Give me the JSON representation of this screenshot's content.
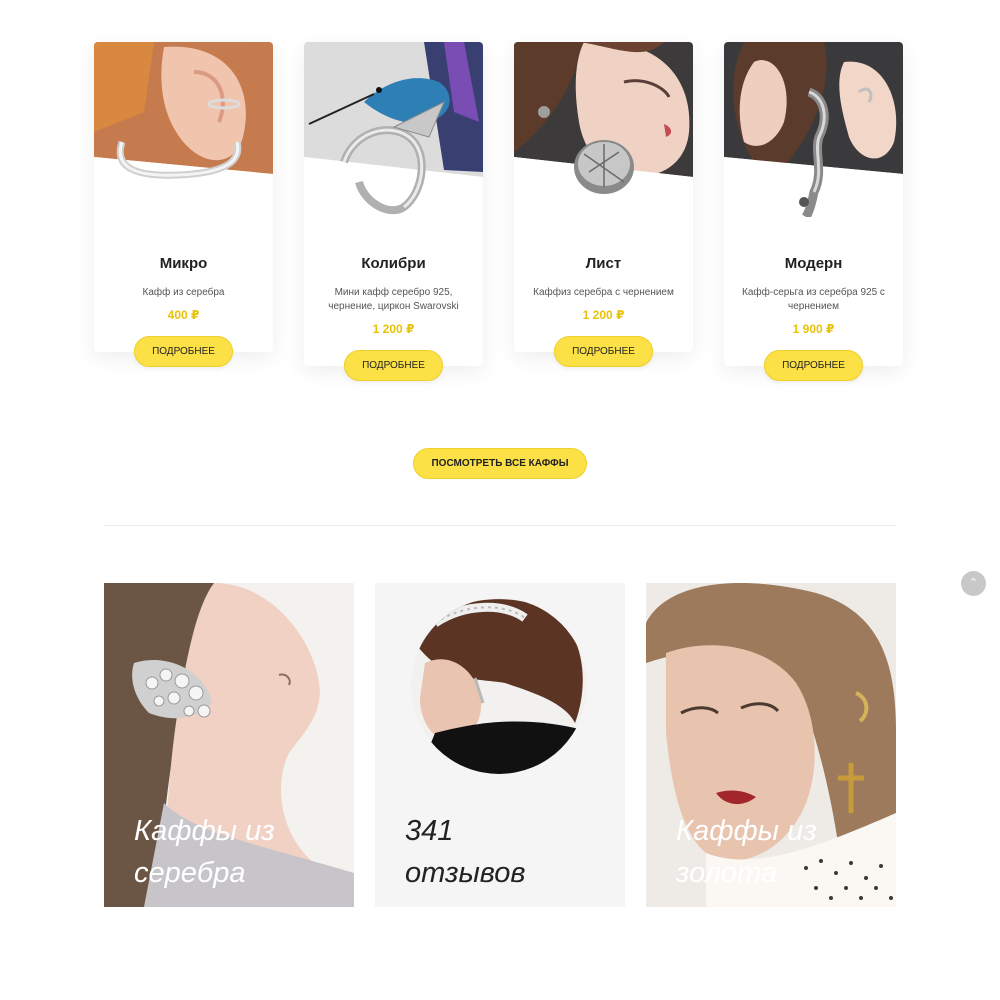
{
  "products": [
    {
      "title": "Микро",
      "desc_lines": [
        "Кафф из серебра"
      ],
      "price": "400 ₽",
      "button": "ПОДРОБНЕЕ",
      "image_icon": "silver-ear-cuff-image"
    },
    {
      "title": "Колибри",
      "desc_lines": [
        "Мини кафф серебро 925,",
        "чернение, циркон Swarovski"
      ],
      "price": "1 200 ₽",
      "button": "ПОДРОБНЕЕ",
      "image_icon": "hummingbird-cuff-image"
    },
    {
      "title": "Лист",
      "desc_lines": [
        "Каффиз серебра с чернением"
      ],
      "price": "1 200 ₽",
      "button": "ПОДРОБНЕЕ",
      "image_icon": "leaf-cuff-image"
    },
    {
      "title": "Модерн",
      "desc_lines": [
        "Кафф-серьга из серебра 925 с",
        "чернением"
      ],
      "price": "1 900 ₽",
      "button": "ПОДРОБНЕЕ",
      "image_icon": "modern-cuff-image"
    }
  ],
  "view_all_button": "ПОСМОТРЕТЬ ВСЕ КАФФЫ",
  "scroll_top_icon": "⌃",
  "tiles": [
    {
      "lines": [
        "Каффы из",
        "серебра"
      ],
      "color": "#ffffff"
    },
    {
      "lines": [
        "341",
        "отзывов"
      ],
      "color": "#222222"
    },
    {
      "lines": [
        "Каффы из",
        "золота"
      ],
      "color": "#ffffff"
    }
  ],
  "colors": {
    "accent": "#fbe046",
    "price": "#e8c10b"
  }
}
